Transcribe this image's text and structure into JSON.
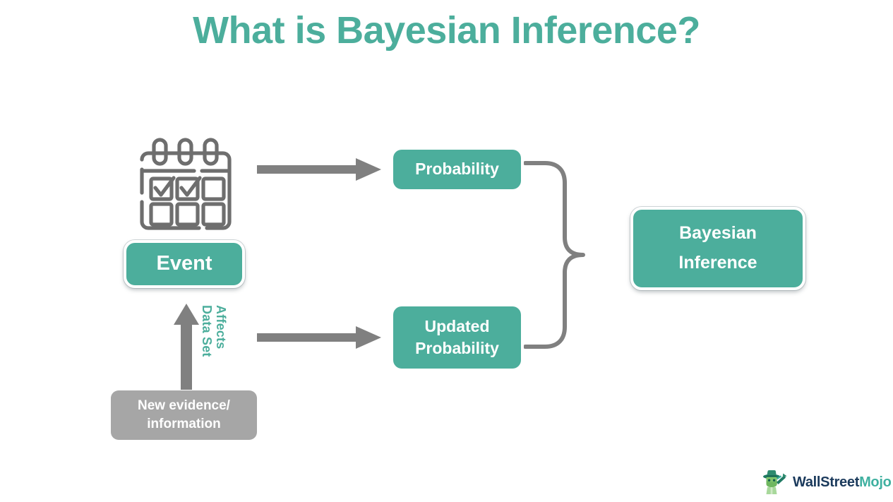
{
  "title": "What is Bayesian Inference?",
  "theme": {
    "teal": "#4CAE9C",
    "gray": "#A6A6A6",
    "arrow_gray": "#808080",
    "icon_gray": "#6E6E6E",
    "white": "#FFFFFF",
    "background": "#FFFFFF"
  },
  "nodes": {
    "event": {
      "label": "Event"
    },
    "probability": {
      "label": "Probability"
    },
    "updated_probability": {
      "line1": "Updated",
      "line2": "Probability"
    },
    "bayesian_inference": {
      "line1": "Bayesian",
      "line2": "Inference"
    },
    "new_evidence": {
      "line1": "New evidence/",
      "line2": "information"
    }
  },
  "labels": {
    "affects": "Affects",
    "data_set": "Data Set"
  },
  "icons": {
    "calendar": "calendar-icon",
    "arrow_right_top": "arrow-right-icon",
    "arrow_right_bottom": "arrow-right-icon",
    "arrow_up": "arrow-up-icon",
    "brace": "curly-brace-icon",
    "logo_mark": "wallstreetmojo-mascot-icon"
  },
  "brand": {
    "name_part1": "WallStreet",
    "name_part2": "Mojo"
  }
}
